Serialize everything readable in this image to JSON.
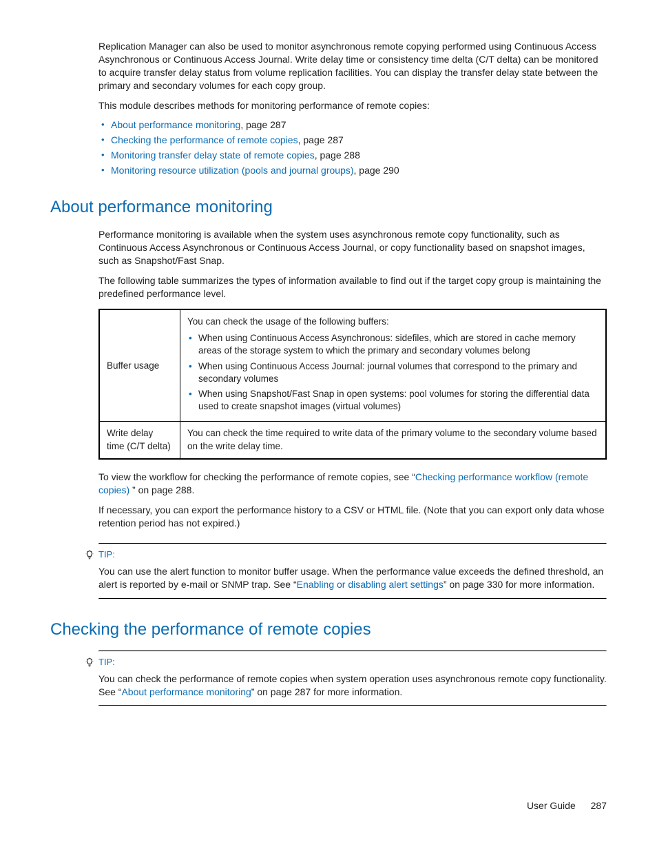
{
  "intro": {
    "p1": "Replication Manager can also be used to monitor asynchronous remote copying performed using Continuous Access Asynchronous or Continuous Access Journal. Write delay time or consistency time delta (C/T delta) can be monitored to acquire transfer delay status from volume replication facilities. You can display the transfer delay state between the primary and secondary volumes for each copy group.",
    "p2": "This module describes methods for monitoring performance of remote copies:",
    "links": [
      {
        "text": "About performance monitoring",
        "suffix": ", page 287"
      },
      {
        "text": "Checking the performance of remote copies",
        "suffix": ", page 287"
      },
      {
        "text": "Monitoring transfer delay state of remote copies",
        "suffix": ", page 288"
      },
      {
        "text": "Monitoring resource utilization (pools and journal groups)",
        "suffix": ", page 290"
      }
    ]
  },
  "section1": {
    "heading": "About performance monitoring",
    "p1": "Performance monitoring is available when the system uses asynchronous remote copy functionality, such as Continuous Access Asynchronous or Continuous Access Journal, or copy functionality based on snapshot images, such as Snapshot/Fast Snap.",
    "p2": "The following table summarizes the types of information available to find out if the target copy group is maintaining the predefined performance level.",
    "table": {
      "r1label": "Buffer usage",
      "r1intro": "You can check the usage of the following buffers:",
      "r1b1": "When using Continuous Access Asynchronous: sidefiles, which are stored in cache memory areas of the storage system to which the primary and secondary volumes belong",
      "r1b2": "When using Continuous Access Journal: journal volumes that correspond to the primary and secondary volumes",
      "r1b3": "When using Snapshot/Fast Snap in open systems: pool volumes for storing the differential data used to create snapshot images (virtual volumes)",
      "r2label": "Write delay time (C/T delta)",
      "r2text": "You can check the time required to write data of the primary volume to the secondary volume based on the write delay time."
    },
    "after1a": "To view the workflow for checking the performance of remote copies, see “",
    "after1link": "Checking performance workflow (remote copies)  ",
    "after1b": "” on page 288.",
    "after2": "If necessary, you can export the performance history to a CSV or HTML file. (Note that you can export only data whose retention period has not expired.)",
    "tipLabel": "TIP:",
    "tip1a": "You can use the alert function to monitor buffer usage. When the performance value exceeds the defined threshold, an alert is reported by e-mail or SNMP trap. See “",
    "tip1link": "Enabling or disabling alert settings",
    "tip1b": "” on page 330 for more information."
  },
  "section2": {
    "heading": "Checking the performance of remote copies",
    "tipLabel": "TIP:",
    "tip1a": "You can check the performance of remote copies when system operation uses asynchronous remote copy functionality. See “",
    "tip1link": "About performance monitoring",
    "tip1b": "” on page 287 for more information."
  },
  "footer": {
    "label": "User Guide",
    "page": "287"
  }
}
